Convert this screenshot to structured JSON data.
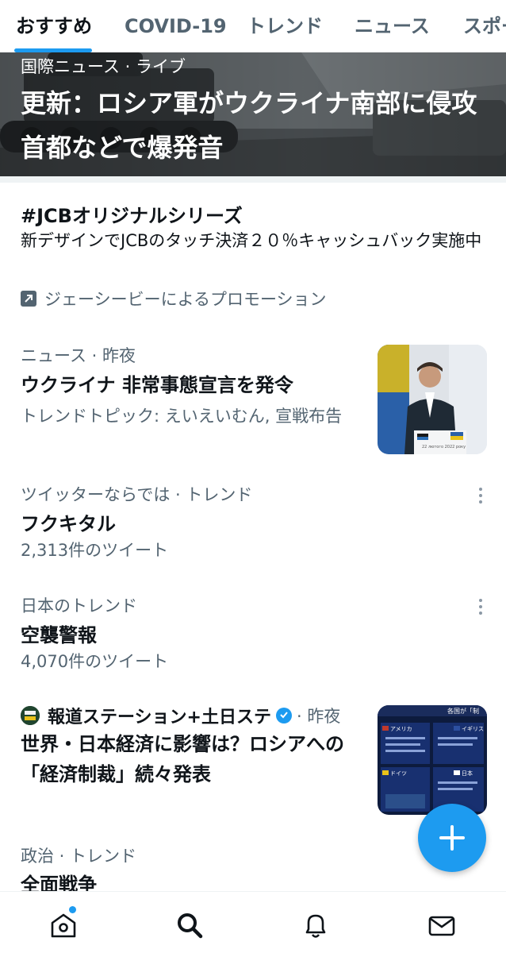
{
  "tabs": [
    {
      "label": "おすすめ",
      "active": true
    },
    {
      "label": "COVID-19",
      "active": false
    },
    {
      "label": "トレンド",
      "active": false
    },
    {
      "label": "ニュース",
      "active": false
    },
    {
      "label": "スポー",
      "active": false
    }
  ],
  "hero": {
    "category": "国際ニュース · ライブ",
    "title": "更新：ロシア軍がウクライナ南部に侵攻 首都などで爆発音"
  },
  "promo": {
    "title": "#JCBオリジナルシリーズ",
    "description": "新デザインでJCBのタッチ決済２０％キャッシュバック実施中",
    "promoted_by": "ジェーシービーによるプロモーション"
  },
  "items": [
    {
      "meta": "ニュース · 昨夜",
      "title": "ウクライナ 非常事態宣言を発令",
      "sub": "トレンドトピック: えいえいむん, 宣戦布告",
      "thumb_caption": "22 лютого 2022 року"
    },
    {
      "meta": "ツイッターならでは · トレンド",
      "title": "フクキタル",
      "sub": "2,313件のツイート"
    },
    {
      "meta": "日本のトレンド",
      "title": "空襲警報",
      "sub": "4,070件のツイート"
    },
    {
      "source": "報道ステーション+土日ステ",
      "time": "· 昨夜",
      "title": "世界・日本経済に影響は？ロシアへの「経済制裁」続々発表",
      "thumb_labels": [
        "各国が「制",
        "アメリカ",
        "イギリス",
        "ドイツ",
        "日本"
      ]
    },
    {
      "meta": "政治 · トレンド",
      "title": "全面戦争"
    }
  ],
  "nav": [
    {
      "icon": "home-icon",
      "badge": true
    },
    {
      "icon": "search-icon",
      "active": true
    },
    {
      "icon": "bell-icon"
    },
    {
      "icon": "mail-icon"
    }
  ],
  "colors": {
    "accent": "#1d9bf0",
    "text": "#0f1419",
    "secondary": "#536471",
    "divider": "#eff3f4"
  }
}
